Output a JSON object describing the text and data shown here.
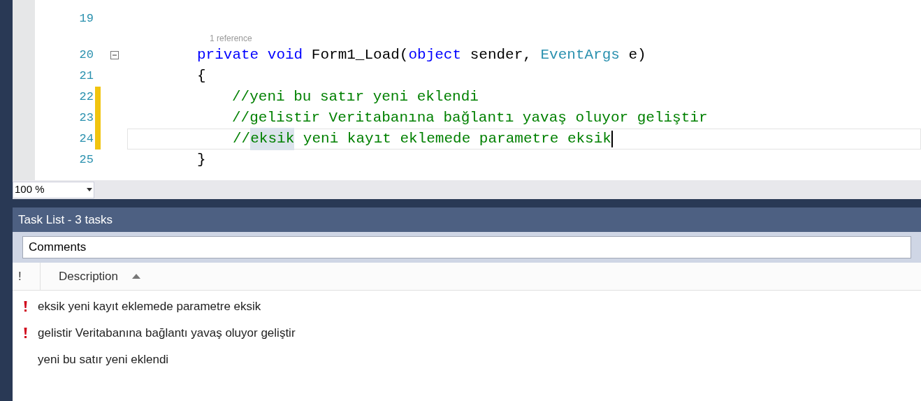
{
  "editor": {
    "lines": [
      {
        "number": "19",
        "changed": false
      },
      {
        "number": "20",
        "changed": false,
        "codelens": "1 reference",
        "fold": {
          "expanded": true
        },
        "tokens": [
          {
            "kind": "keyword",
            "text": "private"
          },
          {
            "kind": "keyword",
            "text": "void"
          },
          {
            "kind": "plain",
            "text": "Form1_Load("
          },
          {
            "kind": "keyword",
            "text": "object"
          },
          {
            "kind": "plain",
            "text": "sender,"
          },
          {
            "kind": "type",
            "text": "EventArgs"
          },
          {
            "kind": "plain",
            "text": "e)"
          }
        ]
      },
      {
        "number": "21",
        "changed": false,
        "tokens": [
          {
            "kind": "plain",
            "text": "{"
          }
        ]
      },
      {
        "number": "22",
        "changed": true,
        "indented": true,
        "tokens": [
          {
            "kind": "comment",
            "text": "//yeni bu satır yeni eklendi"
          }
        ]
      },
      {
        "number": "23",
        "changed": true,
        "indented": true,
        "tokens": [
          {
            "kind": "comment",
            "text": "//gelistir Veritabanına bağlantı yavaş oluyor geliştir"
          }
        ]
      },
      {
        "number": "24",
        "changed": true,
        "indented": true,
        "current": true,
        "caret": true,
        "tokens": [
          {
            "kind": "comment",
            "text": "//"
          },
          {
            "kind": "comment",
            "text": "eksik",
            "highlighted": true
          },
          {
            "kind": "comment",
            "text": "yeni kayıt eklemede parametre eksik"
          }
        ]
      },
      {
        "number": "25",
        "changed": false,
        "tokens": [
          {
            "kind": "plain",
            "text": "}"
          }
        ]
      }
    ],
    "zoom": "100 %"
  },
  "task_list": {
    "title": "Task List - 3 tasks",
    "filter": "Comments",
    "columns": [
      "!",
      "Description"
    ],
    "tasks": [
      {
        "high_priority": true,
        "description": "eksik yeni kayıt eklemede parametre eksik"
      },
      {
        "high_priority": true,
        "description": "gelistir Veritabanına bağlantı yavaş oluyor geliştir"
      },
      {
        "high_priority": false,
        "description": "yeni bu satır yeni eklendi"
      }
    ]
  }
}
